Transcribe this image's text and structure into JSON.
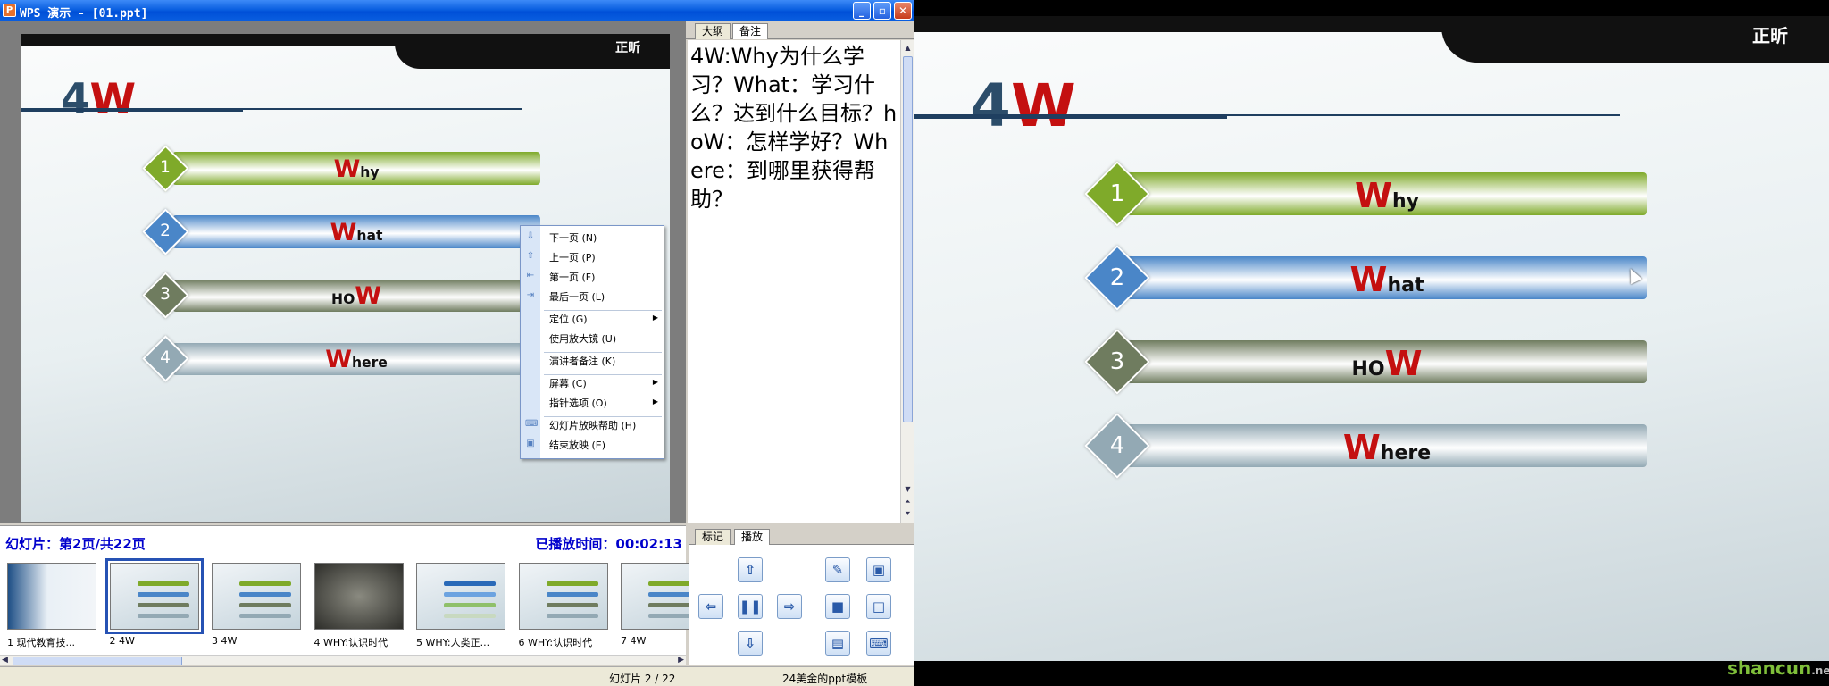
{
  "window": {
    "app_icon": "P",
    "title": "WPS 演示 - [01.ppt]",
    "controls": [
      "_",
      "▫",
      "✕"
    ]
  },
  "panel_tabs": {
    "outline": "大纲",
    "notes": "备注"
  },
  "notes_text": "4W:Why为什么学习？What：学习什么？达到什么目标？hoW：怎样学好？Where：到哪里获得帮助？",
  "slide": {
    "logo": "正昕",
    "title_digit": "4",
    "title_letter": "W",
    "items": [
      {
        "num": "1",
        "cap": "W",
        "rest": "hy",
        "cap_after": false,
        "color": "#7faa2a"
      },
      {
        "num": "2",
        "cap": "W",
        "rest": "hat",
        "cap_after": false,
        "color": "#4a86c8"
      },
      {
        "num": "3",
        "cap": "W",
        "rest": "HO",
        "cap_after": true,
        "color": "#6f7c5f"
      },
      {
        "num": "4",
        "cap": "W",
        "rest": "here",
        "cap_after": false,
        "color": "#93a9b4"
      }
    ]
  },
  "context_menu": [
    {
      "label": "下一页 (N)",
      "icon": "down-arrow-icon",
      "glyph": "⇩"
    },
    {
      "label": "上一页 (P)",
      "icon": "up-arrow-icon",
      "glyph": "⇧"
    },
    {
      "label": "第一页 (F)",
      "icon": "first-page-icon",
      "glyph": "⇤"
    },
    {
      "label": "最后一页 (L)",
      "icon": "last-page-icon",
      "glyph": "⇥"
    },
    {
      "label": "定位 (G)",
      "submenu": true
    },
    {
      "label": "使用放大镜 (U)"
    },
    {
      "label": "演讲者备注 (K)"
    },
    {
      "label": "屏幕 (C)",
      "submenu": true
    },
    {
      "label": "指针选项 (O)",
      "submenu": true
    },
    {
      "label": "幻灯片放映帮助 (H)",
      "icon": "keyboard-icon",
      "glyph": "⌨"
    },
    {
      "label": "结束放映 (E)",
      "icon": "end-show-icon",
      "glyph": "▣"
    }
  ],
  "status": {
    "slide_info": "幻灯片：第2页/共22页",
    "elapsed": "已播放时间：00:02:13"
  },
  "thumbnails": [
    {
      "label": "1 现代教育技..."
    },
    {
      "label": "2 4W",
      "selected": true
    },
    {
      "label": "3 4W"
    },
    {
      "label": "4 WHY:认识时代"
    },
    {
      "label": "5 WHY:人类正..."
    },
    {
      "label": "6 WHY:认识时代"
    },
    {
      "label": "7 4W"
    }
  ],
  "play_tabs": {
    "mark": "标记",
    "play": "播放"
  },
  "bottom_status": {
    "slide_counter": "幻灯片 2 / 22",
    "template": "24美金的ppt模板"
  },
  "watermark": {
    "text": "shancun",
    "suffix": ".net"
  }
}
